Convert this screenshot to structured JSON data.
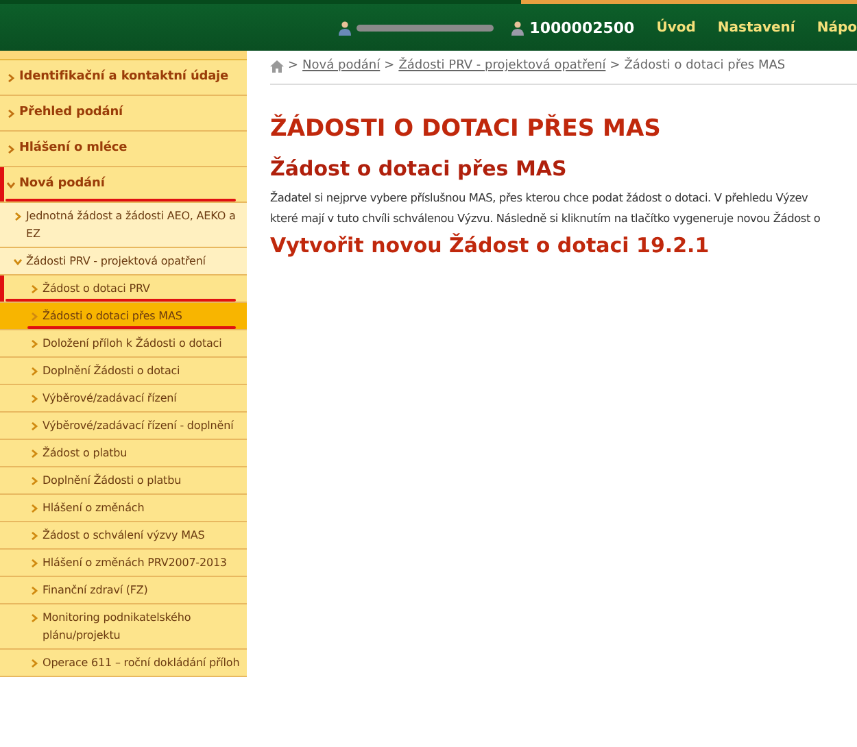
{
  "header": {
    "account": "1000002500",
    "nav": [
      {
        "label": "Úvod"
      },
      {
        "label": "Nastavení"
      },
      {
        "label": "Nápo"
      }
    ]
  },
  "sidebar": {
    "items": [
      {
        "label": "Identifikační a kontaktní údaje",
        "expanded": false,
        "selected": false
      },
      {
        "label": "Přehled podání",
        "expanded": false,
        "selected": false
      },
      {
        "label": "Hlášení o mléce",
        "expanded": false,
        "selected": false
      },
      {
        "label": "Nová podání",
        "expanded": true,
        "selected": false,
        "bracketed": true,
        "children": [
          {
            "label": "Jednotná žádost a žádosti AEO, AEKO a EZ",
            "expanded": false,
            "selected": false
          },
          {
            "label": "Žádosti PRV - projektová opatření",
            "expanded": true,
            "selected": false,
            "children": [
              {
                "label": "Žádost o dotaci PRV",
                "expanded": false,
                "selected": false,
                "bracketed": true
              },
              {
                "label": "Žádosti o dotaci přes MAS",
                "expanded": false,
                "selected": true,
                "underlined": true
              },
              {
                "label": "Doložení příloh k Žádosti o dotaci",
                "expanded": false,
                "selected": false
              },
              {
                "label": "Doplnění Žádosti o dotaci",
                "expanded": false,
                "selected": false
              },
              {
                "label": "Výběrové/zadávací řízení",
                "expanded": false,
                "selected": false
              },
              {
                "label": "Výběrové/zadávací řízení - doplnění",
                "expanded": false,
                "selected": false
              },
              {
                "label": "Žádost o platbu",
                "expanded": false,
                "selected": false
              },
              {
                "label": "Doplnění Žádosti o platbu",
                "expanded": false,
                "selected": false
              },
              {
                "label": "Hlášení o změnách",
                "expanded": false,
                "selected": false
              },
              {
                "label": "Žádost o schválení výzvy MAS",
                "expanded": false,
                "selected": false
              },
              {
                "label": "Hlášení o změnách PRV2007-2013",
                "expanded": false,
                "selected": false
              },
              {
                "label": "Finanční zdraví (FZ)",
                "expanded": false,
                "selected": false
              },
              {
                "label": "Monitoring podnikatelského plánu/projektu",
                "expanded": false,
                "selected": false
              },
              {
                "label": "Operace 611 – roční dokládání příloh",
                "expanded": false,
                "selected": false
              }
            ]
          }
        ]
      }
    ]
  },
  "breadcrumb": [
    {
      "separator": ">",
      "label": "Nová podání",
      "link": true
    },
    {
      "separator": ">",
      "label": "Žádosti PRV - projektová opatření",
      "link": true
    },
    {
      "separator": ">",
      "label": "Žádosti o dotaci přes MAS",
      "link": false
    }
  ],
  "main": {
    "title": "ŽÁDOSTI O DOTACI PŘES MAS",
    "subtitle": "Žádost o dotaci přes MAS",
    "paragraph_lines": [
      "Žadatel si nejprve vybere příslušnou MAS, přes kterou chce podat žádost o dotaci. V přehledu Výzev",
      "které mají v tuto chvíli schválenou Výzvu. Následně si kliknutím na tlačítko vygeneruje novou Žádost o"
    ],
    "action_link": "Vytvořit novou Žádost o dotaci 19.2.1"
  }
}
